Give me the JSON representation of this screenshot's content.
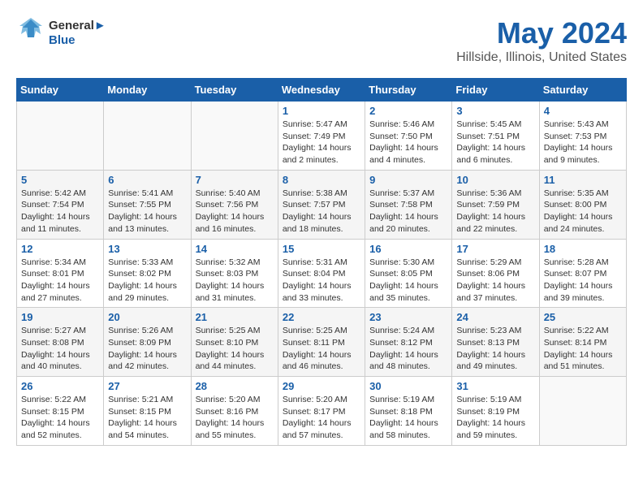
{
  "header": {
    "logo_line1": "General",
    "logo_line2": "Blue",
    "title": "May 2024",
    "subtitle": "Hillside, Illinois, United States"
  },
  "calendar": {
    "days_of_week": [
      "Sunday",
      "Monday",
      "Tuesday",
      "Wednesday",
      "Thursday",
      "Friday",
      "Saturday"
    ],
    "weeks": [
      [
        {
          "day": "",
          "info": ""
        },
        {
          "day": "",
          "info": ""
        },
        {
          "day": "",
          "info": ""
        },
        {
          "day": "1",
          "info": "Sunrise: 5:47 AM\nSunset: 7:49 PM\nDaylight: 14 hours\nand 2 minutes."
        },
        {
          "day": "2",
          "info": "Sunrise: 5:46 AM\nSunset: 7:50 PM\nDaylight: 14 hours\nand 4 minutes."
        },
        {
          "day": "3",
          "info": "Sunrise: 5:45 AM\nSunset: 7:51 PM\nDaylight: 14 hours\nand 6 minutes."
        },
        {
          "day": "4",
          "info": "Sunrise: 5:43 AM\nSunset: 7:53 PM\nDaylight: 14 hours\nand 9 minutes."
        }
      ],
      [
        {
          "day": "5",
          "info": "Sunrise: 5:42 AM\nSunset: 7:54 PM\nDaylight: 14 hours\nand 11 minutes."
        },
        {
          "day": "6",
          "info": "Sunrise: 5:41 AM\nSunset: 7:55 PM\nDaylight: 14 hours\nand 13 minutes."
        },
        {
          "day": "7",
          "info": "Sunrise: 5:40 AM\nSunset: 7:56 PM\nDaylight: 14 hours\nand 16 minutes."
        },
        {
          "day": "8",
          "info": "Sunrise: 5:38 AM\nSunset: 7:57 PM\nDaylight: 14 hours\nand 18 minutes."
        },
        {
          "day": "9",
          "info": "Sunrise: 5:37 AM\nSunset: 7:58 PM\nDaylight: 14 hours\nand 20 minutes."
        },
        {
          "day": "10",
          "info": "Sunrise: 5:36 AM\nSunset: 7:59 PM\nDaylight: 14 hours\nand 22 minutes."
        },
        {
          "day": "11",
          "info": "Sunrise: 5:35 AM\nSunset: 8:00 PM\nDaylight: 14 hours\nand 24 minutes."
        }
      ],
      [
        {
          "day": "12",
          "info": "Sunrise: 5:34 AM\nSunset: 8:01 PM\nDaylight: 14 hours\nand 27 minutes."
        },
        {
          "day": "13",
          "info": "Sunrise: 5:33 AM\nSunset: 8:02 PM\nDaylight: 14 hours\nand 29 minutes."
        },
        {
          "day": "14",
          "info": "Sunrise: 5:32 AM\nSunset: 8:03 PM\nDaylight: 14 hours\nand 31 minutes."
        },
        {
          "day": "15",
          "info": "Sunrise: 5:31 AM\nSunset: 8:04 PM\nDaylight: 14 hours\nand 33 minutes."
        },
        {
          "day": "16",
          "info": "Sunrise: 5:30 AM\nSunset: 8:05 PM\nDaylight: 14 hours\nand 35 minutes."
        },
        {
          "day": "17",
          "info": "Sunrise: 5:29 AM\nSunset: 8:06 PM\nDaylight: 14 hours\nand 37 minutes."
        },
        {
          "day": "18",
          "info": "Sunrise: 5:28 AM\nSunset: 8:07 PM\nDaylight: 14 hours\nand 39 minutes."
        }
      ],
      [
        {
          "day": "19",
          "info": "Sunrise: 5:27 AM\nSunset: 8:08 PM\nDaylight: 14 hours\nand 40 minutes."
        },
        {
          "day": "20",
          "info": "Sunrise: 5:26 AM\nSunset: 8:09 PM\nDaylight: 14 hours\nand 42 minutes."
        },
        {
          "day": "21",
          "info": "Sunrise: 5:25 AM\nSunset: 8:10 PM\nDaylight: 14 hours\nand 44 minutes."
        },
        {
          "day": "22",
          "info": "Sunrise: 5:25 AM\nSunset: 8:11 PM\nDaylight: 14 hours\nand 46 minutes."
        },
        {
          "day": "23",
          "info": "Sunrise: 5:24 AM\nSunset: 8:12 PM\nDaylight: 14 hours\nand 48 minutes."
        },
        {
          "day": "24",
          "info": "Sunrise: 5:23 AM\nSunset: 8:13 PM\nDaylight: 14 hours\nand 49 minutes."
        },
        {
          "day": "25",
          "info": "Sunrise: 5:22 AM\nSunset: 8:14 PM\nDaylight: 14 hours\nand 51 minutes."
        }
      ],
      [
        {
          "day": "26",
          "info": "Sunrise: 5:22 AM\nSunset: 8:15 PM\nDaylight: 14 hours\nand 52 minutes."
        },
        {
          "day": "27",
          "info": "Sunrise: 5:21 AM\nSunset: 8:15 PM\nDaylight: 14 hours\nand 54 minutes."
        },
        {
          "day": "28",
          "info": "Sunrise: 5:20 AM\nSunset: 8:16 PM\nDaylight: 14 hours\nand 55 minutes."
        },
        {
          "day": "29",
          "info": "Sunrise: 5:20 AM\nSunset: 8:17 PM\nDaylight: 14 hours\nand 57 minutes."
        },
        {
          "day": "30",
          "info": "Sunrise: 5:19 AM\nSunset: 8:18 PM\nDaylight: 14 hours\nand 58 minutes."
        },
        {
          "day": "31",
          "info": "Sunrise: 5:19 AM\nSunset: 8:19 PM\nDaylight: 14 hours\nand 59 minutes."
        },
        {
          "day": "",
          "info": ""
        }
      ]
    ]
  }
}
